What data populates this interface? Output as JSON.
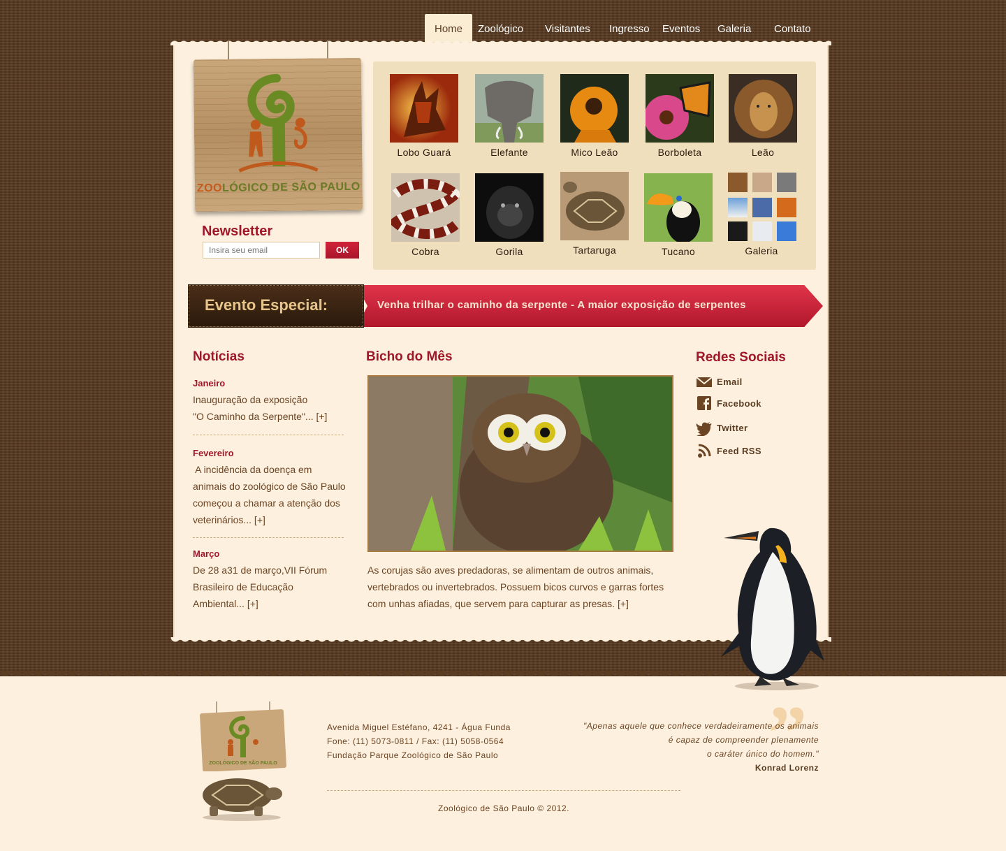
{
  "nav": {
    "items": [
      "Home",
      "Zoológico",
      "Visitantes",
      "Ingresso",
      "Eventos",
      "Galeria",
      "Contato"
    ],
    "active": "Home"
  },
  "logo": {
    "text_prefix": "ZOO",
    "text_rest": "LÓGICO DE SÃO PAULO"
  },
  "newsletter": {
    "title": "Newsletter",
    "placeholder": "Insira seu email",
    "button": "OK"
  },
  "gallery": {
    "items": [
      {
        "label": "Lobo Guará",
        "icon": "wolf-photo"
      },
      {
        "label": "Elefante",
        "icon": "elephant-photo"
      },
      {
        "label": "Mico Leão",
        "icon": "tamarin-photo"
      },
      {
        "label": "Borboleta",
        "icon": "butterfly-photo"
      },
      {
        "label": "Leão",
        "icon": "lion-photo"
      },
      {
        "label": "Cobra",
        "icon": "snake-photo"
      },
      {
        "label": "Gorila",
        "icon": "gorilla-photo"
      },
      {
        "label": "Tartaruga",
        "icon": "tortoise-photo"
      },
      {
        "label": "Tucano",
        "icon": "toucan-photo"
      },
      {
        "label": "Galeria",
        "icon": "gallery-mosaic"
      }
    ]
  },
  "event": {
    "label": "Evento Especial:",
    "text": "Venha trilhar o caminho da serpente - A maior exposição de serpentes"
  },
  "news": {
    "title": "Notícias",
    "items": [
      {
        "month": "Janeiro",
        "lines": [
          "Inauguração da exposição",
          "\"O Caminho da Serpente\"... [+]"
        ]
      },
      {
        "month": "Fevereiro",
        "lines": [
          " A incidência da doença em",
          "animais do zoológico de São Paulo",
          "começou a chamar a atenção dos",
          "veterinários... [+]"
        ]
      },
      {
        "month": "Março",
        "lines": [
          "De 28 a31 de março,VII Fórum",
          "Brasileiro de Educação",
          "Ambiental... [+]"
        ]
      }
    ]
  },
  "bicho": {
    "title": "Bicho do Mês",
    "lines": [
      "As corujas são aves predadoras, se alimentam de outros animais,",
      "vertebrados ou invertebrados. Possuem bicos curvos e garras fortes",
      "com unhas afiadas, que servem para capturar as presas. [+]"
    ]
  },
  "social": {
    "title": "Redes Sociais",
    "items": [
      {
        "label": "Email",
        "icon": "email-icon"
      },
      {
        "label": "Facebook",
        "icon": "facebook-icon"
      },
      {
        "label": "Twitter",
        "icon": "twitter-icon"
      },
      {
        "label": "Feed RSS",
        "icon": "rss-icon"
      }
    ]
  },
  "footer": {
    "address": [
      "Avenida Miguel Estéfano, 4241 - Água Funda",
      "Fone: (11) 5073-0811 / Fax: (11) 5058-0564",
      "Fundação Parque Zoológico de São Paulo"
    ],
    "copyright": "Zoológico de São Paulo © 2012.",
    "quote_lines": [
      "\"Apenas aquele que conhece verdadeiramente os animais",
      "é capaz de compreender plenamente",
      "o caráter único do homem.\""
    ],
    "quote_author": "Konrad Lorenz"
  },
  "colors": {
    "brown_dark": "#5a3c22",
    "paper": "#fdf0de",
    "accent_red": "#a0172a",
    "text_brown": "#6b4424"
  }
}
